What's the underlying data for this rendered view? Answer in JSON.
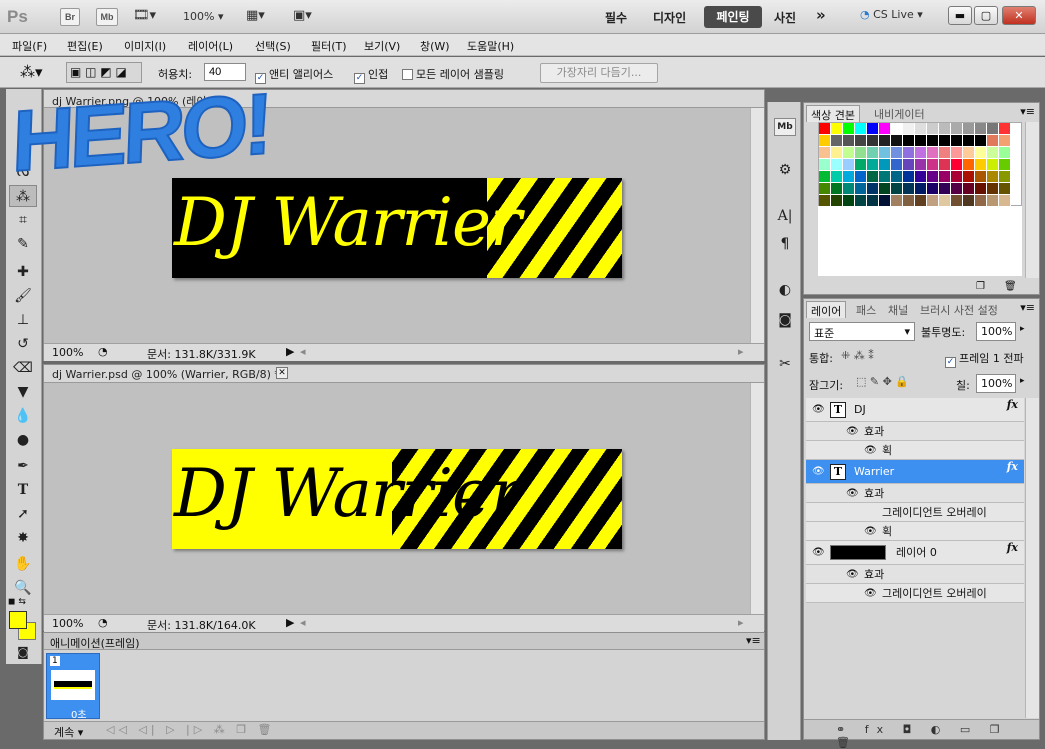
{
  "appbar": {
    "logo": "Ps",
    "br": "Br",
    "mb": "Mb",
    "zoom": "100%",
    "workspaces": [
      "필수",
      "디자인",
      "페인팅",
      "사진"
    ],
    "more": "»",
    "cslive": "CS Live"
  },
  "menu": [
    "파일(F)",
    "편집(E)",
    "이미지(I)",
    "레이어(L)",
    "선택(S)",
    "필터(T)",
    "보기(V)",
    "창(W)",
    "도움말(H)"
  ],
  "options": {
    "tolerance_label": "허용치:",
    "tolerance_value": "40",
    "antialias": "앤티 앨리어스",
    "contiguous": "인접",
    "all_layers": "모든 레이어 샘플링",
    "refine_edge": "가장자리 다듬기..."
  },
  "overlay_text": "HERO!",
  "doc1": {
    "title": "dj Warrier.png @ 100% (레이어 ...",
    "zoom": "100%",
    "status": "문서: 131.8K/331.9K",
    "banner": "DJ Warrier"
  },
  "doc2": {
    "title": "dj Warrier.psd @ 100% (Warrier, RGB/8) *",
    "zoom": "100%",
    "status": "문서: 131.8K/164.0K",
    "banner": "DJ Warrier"
  },
  "animation": {
    "title": "애니메이션(프레임)",
    "frame_number": "1",
    "frame_time": "0초",
    "loop": "계속"
  },
  "swatch_panel": {
    "tabs": [
      "색상 견본",
      "내비게이터"
    ],
    "colors": [
      "#ff0000",
      "#ffff00",
      "#00ff00",
      "#00ffff",
      "#0000ff",
      "#ff00ff",
      "#ffffff",
      "#f0f0f0",
      "#dedede",
      "#cccccc",
      "#bbbbbb",
      "#aaaaaa",
      "#999999",
      "#888888",
      "#777777",
      "#ff3333",
      "#ffcc00",
      "#666666",
      "#555555",
      "#444444",
      "#333333",
      "#222222",
      "#111111",
      "#000000",
      "#000000",
      "#000000",
      "#000000",
      "#000000",
      "#000000",
      "#000000",
      "#e07a5a",
      "#f5a070",
      "#f9c090",
      "#fff090",
      "#c0ff90",
      "#90e090",
      "#70d0b0",
      "#70c0e0",
      "#7090e0",
      "#9070e0",
      "#c070e0",
      "#e070c0",
      "#f08080",
      "#ff9999",
      "#ffcc99",
      "#ffff99",
      "#ccff99",
      "#99ff99",
      "#99ffcc",
      "#99ffff",
      "#99ccff",
      "#00aa66",
      "#00aa99",
      "#0099bb",
      "#3366cc",
      "#6644bb",
      "#9933aa",
      "#cc3388",
      "#dd3355",
      "#ff0033",
      "#ff6600",
      "#ffcc00",
      "#ccee00",
      "#66cc00",
      "#00bb33",
      "#00ccaa",
      "#00aadd",
      "#0066cc",
      "#006644",
      "#007777",
      "#006688",
      "#003399",
      "#330099",
      "#660088",
      "#990066",
      "#aa0033",
      "#aa1100",
      "#aa5500",
      "#aa8800",
      "#889900",
      "#448800",
      "#007722",
      "#008877",
      "#006699",
      "#003366",
      "#004422",
      "#004444",
      "#003355",
      "#001a66",
      "#1a0066",
      "#330055",
      "#550044",
      "#660022",
      "#661100",
      "#663300",
      "#665500",
      "#555500",
      "#224400",
      "#004411",
      "#004444",
      "#003344",
      "#001133",
      "#a08060",
      "#806040",
      "#604020",
      "#c0a080",
      "#e0c8a0",
      "#705030",
      "#503820",
      "#906848",
      "#b89870",
      "#d8b890",
      "#302010"
    ]
  },
  "layers_panel": {
    "tabs": [
      "레이어",
      "패스",
      "채널",
      "브러시 사전 설정"
    ],
    "blend_mode": "표준",
    "opacity_label": "불투명도:",
    "opacity_value": "100%",
    "lock_label": "통합:",
    "frame_label": "프레임 1 전파",
    "lock2_label": "잠그기:",
    "fill_label": "칠:",
    "fill_value": "100%",
    "rows": [
      {
        "name": "DJ",
        "type": "T",
        "indent": 0
      },
      {
        "name": "효과",
        "indent": 1
      },
      {
        "name": "획",
        "indent": 2
      },
      {
        "name": "Warrier",
        "type": "T",
        "indent": 0,
        "selected": true
      },
      {
        "name": "효과",
        "indent": 1
      },
      {
        "name": "그레이디언트 오버레이",
        "indent": 2,
        "noeye": true
      },
      {
        "name": "획",
        "indent": 2
      },
      {
        "name": "레이어 0",
        "type": "img",
        "indent": 0
      },
      {
        "name": "효과",
        "indent": 1
      },
      {
        "name": "그레이디언트 오버레이",
        "indent": 2
      }
    ]
  }
}
